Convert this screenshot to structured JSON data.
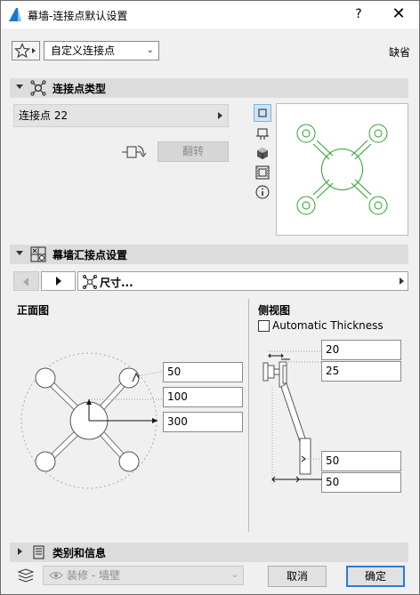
{
  "window": {
    "title": "幕墙-连接点默认设置",
    "help": "?",
    "close": "✕"
  },
  "favorites": {
    "preset": "自定义连接点",
    "default_label": "缺省"
  },
  "panels": {
    "connector_type": {
      "title": "连接点类型"
    },
    "junction_settings": {
      "title": "幕墙汇接点设置"
    },
    "category": {
      "title": "类别和信息"
    }
  },
  "connector": {
    "selected": "连接点 22",
    "flip_label": "翻转"
  },
  "settings_nav": {
    "page_label": "尺寸..."
  },
  "front_view": {
    "label": "正面图",
    "values": [
      "50",
      "100",
      "300"
    ]
  },
  "side_view": {
    "label": "侧视图",
    "auto_thickness_label": "Automatic Thickness",
    "auto_thickness_checked": false,
    "values": [
      "20",
      "25",
      "50",
      "50"
    ]
  },
  "footer": {
    "layer": "装修 - 墙壁",
    "cancel": "取消",
    "ok": "确定"
  },
  "colors": {
    "preview_line": "#2ca02c",
    "ok_border": "#2d7ad6",
    "panel_header": "#dcdcdc"
  }
}
